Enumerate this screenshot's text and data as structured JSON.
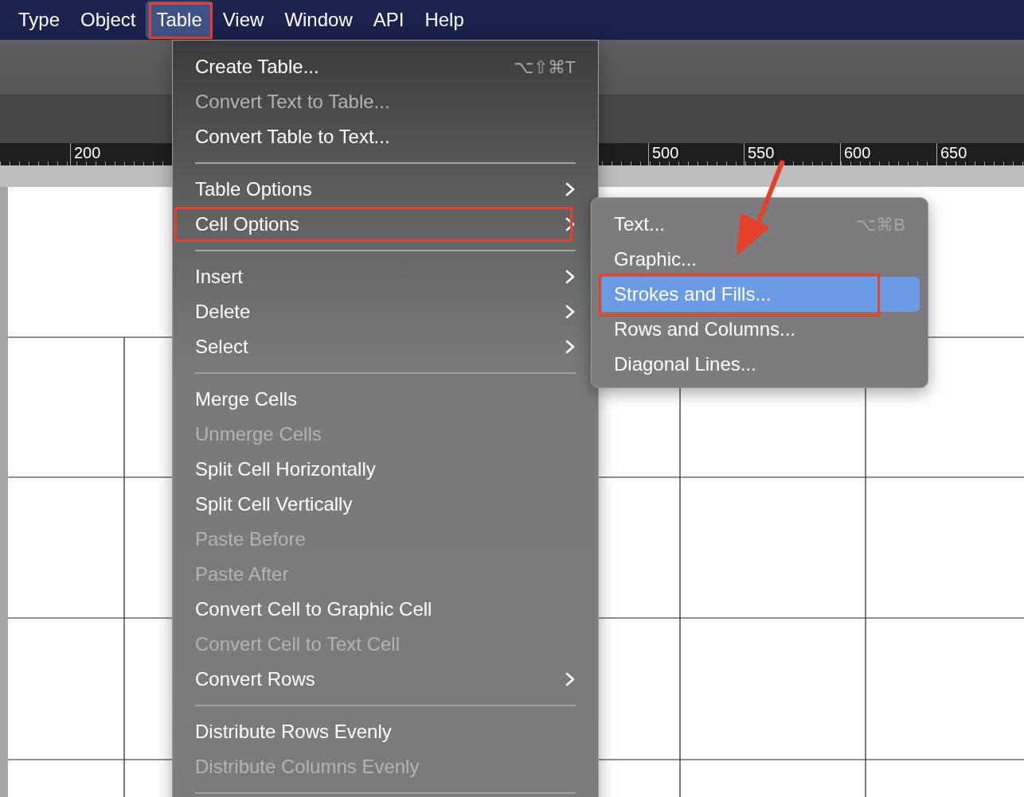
{
  "menubar": [
    {
      "label": "Type",
      "selected": false,
      "annotated": false
    },
    {
      "label": "Object",
      "selected": false,
      "annotated": false
    },
    {
      "label": "Table",
      "selected": true,
      "annotated": true
    },
    {
      "label": "View",
      "selected": false,
      "annotated": false
    },
    {
      "label": "Window",
      "selected": false,
      "annotated": false
    },
    {
      "label": "API",
      "selected": false,
      "annotated": false
    },
    {
      "label": "Help",
      "selected": false,
      "annotated": false
    }
  ],
  "ruler": {
    "labels": [
      "200",
      "500",
      "550",
      "600",
      "650"
    ]
  },
  "table_menu": [
    {
      "kind": "item",
      "label": "Create Table...",
      "shortcut": "⌥⇧⌘T",
      "disabled": false,
      "submenu": false,
      "annotated": false
    },
    {
      "kind": "item",
      "label": "Convert Text to Table...",
      "disabled": true,
      "submenu": false,
      "annotated": false
    },
    {
      "kind": "item",
      "label": "Convert Table to Text...",
      "disabled": false,
      "submenu": false,
      "annotated": false
    },
    {
      "kind": "separator"
    },
    {
      "kind": "item",
      "label": "Table Options",
      "disabled": false,
      "submenu": true,
      "annotated": false
    },
    {
      "kind": "item",
      "label": "Cell Options",
      "disabled": false,
      "submenu": true,
      "annotated": true
    },
    {
      "kind": "separator"
    },
    {
      "kind": "item",
      "label": "Insert",
      "disabled": false,
      "submenu": true,
      "annotated": false
    },
    {
      "kind": "item",
      "label": "Delete",
      "disabled": false,
      "submenu": true,
      "annotated": false
    },
    {
      "kind": "item",
      "label": "Select",
      "disabled": false,
      "submenu": true,
      "annotated": false
    },
    {
      "kind": "separator"
    },
    {
      "kind": "item",
      "label": "Merge Cells",
      "disabled": false,
      "submenu": false,
      "annotated": false
    },
    {
      "kind": "item",
      "label": "Unmerge Cells",
      "disabled": true,
      "submenu": false,
      "annotated": false
    },
    {
      "kind": "item",
      "label": "Split Cell Horizontally",
      "disabled": false,
      "submenu": false,
      "annotated": false
    },
    {
      "kind": "item",
      "label": "Split Cell Vertically",
      "disabled": false,
      "submenu": false,
      "annotated": false
    },
    {
      "kind": "item",
      "label": "Paste Before",
      "disabled": true,
      "submenu": false,
      "annotated": false
    },
    {
      "kind": "item",
      "label": "Paste After",
      "disabled": true,
      "submenu": false,
      "annotated": false
    },
    {
      "kind": "item",
      "label": "Convert Cell to Graphic Cell",
      "disabled": false,
      "submenu": false,
      "annotated": false
    },
    {
      "kind": "item",
      "label": "Convert Cell to Text Cell",
      "disabled": true,
      "submenu": false,
      "annotated": false
    },
    {
      "kind": "item",
      "label": "Convert Rows",
      "disabled": false,
      "submenu": true,
      "annotated": false
    },
    {
      "kind": "separator"
    },
    {
      "kind": "item",
      "label": "Distribute Rows Evenly",
      "disabled": false,
      "submenu": false,
      "annotated": false
    },
    {
      "kind": "item",
      "label": "Distribute Columns Evenly",
      "disabled": true,
      "submenu": false,
      "annotated": false
    },
    {
      "kind": "separator"
    }
  ],
  "cell_options_submenu": [
    {
      "label": "Text...",
      "shortcut": "⌥⌘B",
      "selected": false,
      "annotated": false
    },
    {
      "label": "Graphic...",
      "selected": false,
      "annotated": false
    },
    {
      "label": "Strokes and Fills...",
      "selected": true,
      "annotated": true
    },
    {
      "label": "Rows and Columns...",
      "selected": false,
      "annotated": false
    },
    {
      "label": "Diagonal Lines...",
      "selected": false,
      "annotated": false
    }
  ]
}
